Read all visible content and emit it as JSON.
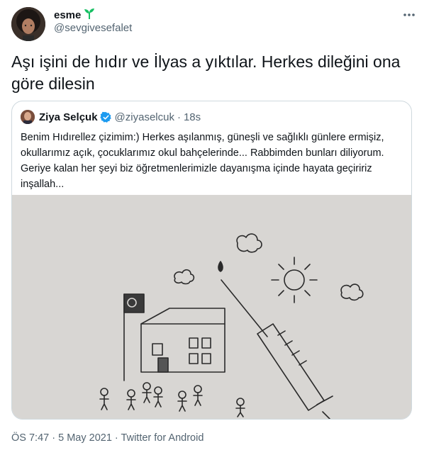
{
  "author": {
    "name": "esme",
    "name_emoji": "seedling-icon",
    "handle": "@sevgivesefalet"
  },
  "tweet": {
    "text": "Aşı işini de hıdır ve İlyas a yıktılar. Herkes dileğini ona göre dilesin"
  },
  "quoted": {
    "author_name": "Ziya Selçuk",
    "verified": true,
    "handle": "@ziyaselcuk",
    "separator": "·",
    "time": "18s",
    "text": "Benim Hıdırellez çizimim:) Herkes aşılanmış, güneşli ve sağlıklı günlere ermişiz, okullarımız açık, çocuklarımız okul bahçelerinde... Rabbimden bunları diliyorum. Geriye kalan her şeyi biz öğretmenlerimizle dayanışma içinde hayata geçiririz inşallah...",
    "image": "drawing-of-school-sun-flag-syringe-children"
  },
  "footer": {
    "time": "ÖS 7:47",
    "sep1": "·",
    "date": "5 May 2021",
    "sep2": "·",
    "source": "Twitter for Android"
  },
  "colors": {
    "text": "#0f1419",
    "secondary": "#536471",
    "border": "#cfd9de",
    "verified": "#1d9bf0",
    "plant": "#17bf63"
  }
}
